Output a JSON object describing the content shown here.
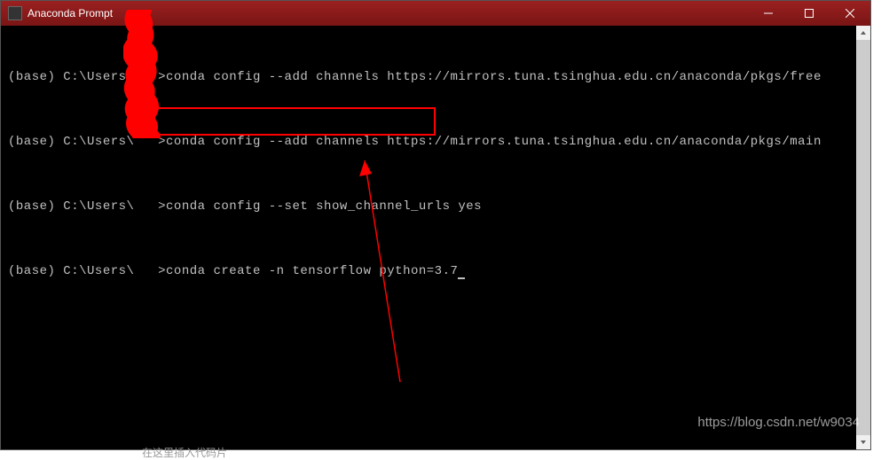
{
  "window": {
    "title": "Anaconda Prompt"
  },
  "terminal": {
    "lines": [
      {
        "prompt": "(base) C:\\Users\\   >",
        "command": "conda config --add channels https://mirrors.tuna.tsinghua.edu.cn/anaconda/pkgs/free"
      },
      {
        "prompt": "(base) C:\\Users\\   >",
        "command": "conda config --add channels https://mirrors.tuna.tsinghua.edu.cn/anaconda/pkgs/main"
      },
      {
        "prompt": "(base) C:\\Users\\   >",
        "command": "conda config --set show_channel_urls yes"
      },
      {
        "prompt": "(base) C:\\Users\\   >",
        "command": "conda create -n tensorflow python=3.7"
      }
    ]
  },
  "watermark": "https://blog.csdn.net/w9034",
  "bottom_hint": "在这里插入代码片"
}
